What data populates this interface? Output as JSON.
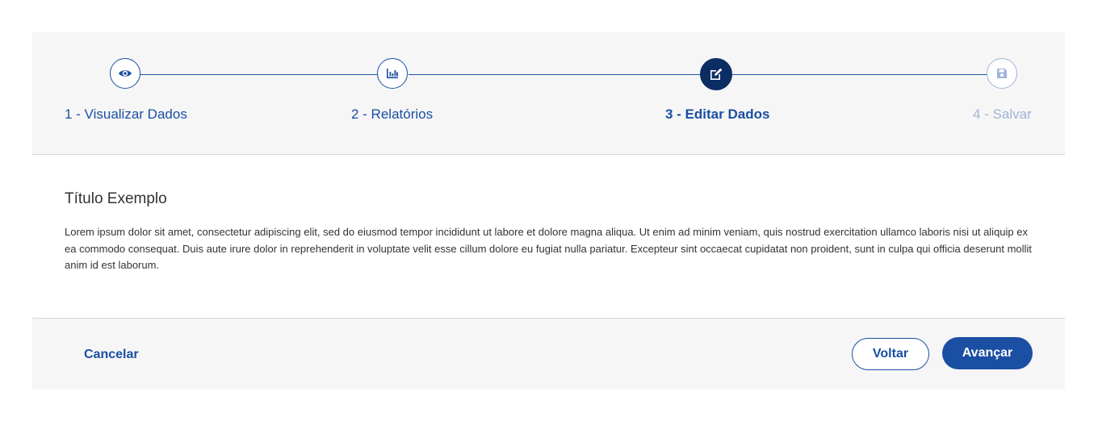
{
  "stepper": {
    "steps": [
      {
        "label": "1 - Visualizar Dados",
        "icon": "eye-icon",
        "state": "completed"
      },
      {
        "label": "2 - Relatórios",
        "icon": "bar-chart-icon",
        "state": "completed"
      },
      {
        "label": "3 - Editar Dados",
        "icon": "edit-icon",
        "state": "active"
      },
      {
        "label": "4 - Salvar",
        "icon": "save-icon",
        "state": "pending"
      }
    ]
  },
  "content": {
    "title": "Título Exemplo",
    "body": "Lorem ipsum dolor sit amet, consectetur adipiscing elit, sed do eiusmod tempor incididunt ut labore et dolore magna aliqua. Ut enim ad minim veniam, quis nostrud exercitation ullamco laboris nisi ut aliquip ex ea commodo consequat. Duis aute irure dolor in reprehenderit in voluptate velit esse cillum dolore eu fugiat nulla pariatur. Excepteur sint occaecat cupidatat non proident, sunt in culpa qui officia deserunt mollit anim id est laborum."
  },
  "footer": {
    "cancel_label": "Cancelar",
    "back_label": "Voltar",
    "next_label": "Avançar"
  },
  "colors": {
    "primary": "#1a4fa3",
    "active_step": "#0c2d63",
    "pending": "#9fb4d8",
    "panel_bg": "#f6f6f6"
  }
}
